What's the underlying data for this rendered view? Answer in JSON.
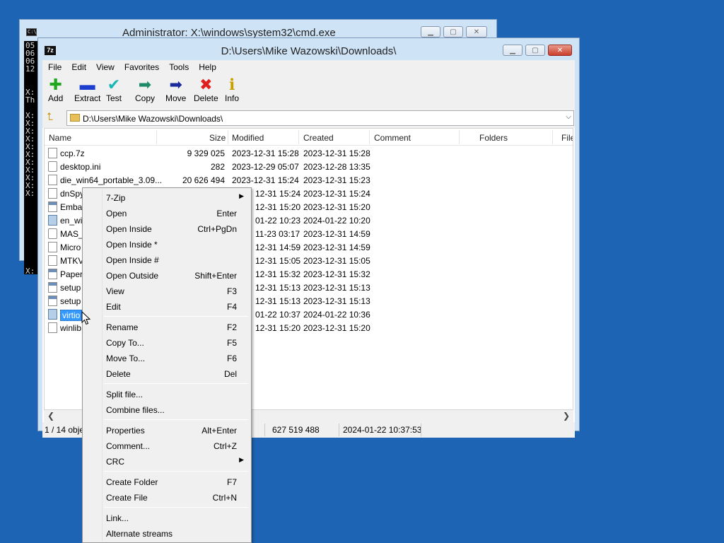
{
  "cmd": {
    "title": "Administrator: X:\\windows\\system32\\cmd.exe",
    "icon_label": "C:\\",
    "lines": [
      "05",
      "06",
      "06",
      "12",
      "",
      "",
      "X:",
      "Th",
      "",
      "X:",
      "X:",
      "X:",
      "X:",
      "X:",
      "X:",
      "X:",
      "X:",
      "X:",
      "X:",
      "X:",
      "",
      "",
      "",
      "",
      "",
      "",
      "",
      "",
      "",
      "X:"
    ]
  },
  "zip": {
    "title": "D:\\Users\\Mike Wazowski\\Downloads\\",
    "icon_label": "7z",
    "menu": [
      "File",
      "Edit",
      "View",
      "Favorites",
      "Tools",
      "Help"
    ],
    "toolbar": [
      {
        "label": "Add",
        "icon": "plus-icon",
        "glyph": "✚",
        "color": "#1fa81f"
      },
      {
        "label": "Extract",
        "icon": "minus-icon",
        "glyph": "▬",
        "color": "#1c3fd0"
      },
      {
        "label": "Test",
        "icon": "check-icon",
        "glyph": "✔",
        "color": "#19b6b6"
      },
      {
        "label": "Copy",
        "icon": "copy-arrow-icon",
        "glyph": "➡",
        "color": "#1e8a6a"
      },
      {
        "label": "Move",
        "icon": "move-arrow-icon",
        "glyph": "➡",
        "color": "#1a2a9a"
      },
      {
        "label": "Delete",
        "icon": "delete-x-icon",
        "glyph": "✖",
        "color": "#e01f1f"
      },
      {
        "label": "Info",
        "icon": "info-icon",
        "glyph": "ℹ",
        "color": "#c9a000"
      }
    ],
    "address": "D:\\Users\\Mike Wazowski\\Downloads\\",
    "columns": {
      "name": "Name",
      "size": "Size",
      "modified": "Modified",
      "created": "Created",
      "comment": "Comment",
      "folders": "Folders",
      "files": "File"
    },
    "files": [
      {
        "name": "ccp.7z",
        "size": "9 329 025",
        "modified": "2023-12-31 15:28",
        "created": "2023-12-31 15:28",
        "icon": "file-icon"
      },
      {
        "name": "desktop.ini",
        "size": "282",
        "modified": "2023-12-29 05:07",
        "created": "2023-12-28 13:35",
        "icon": "settings-file-icon"
      },
      {
        "name": "die_win64_portable_3.09...",
        "size": "20 626 494",
        "modified": "2023-12-31 15:24",
        "created": "2023-12-31 15:23",
        "icon": "file-icon"
      },
      {
        "name": "dnSpy",
        "size": "",
        "modified": "12-31 15:24",
        "created": "2023-12-31 15:24",
        "icon": "file-icon"
      },
      {
        "name": "Emba",
        "size": "",
        "modified": "12-31 15:20",
        "created": "2023-12-31 15:20",
        "icon": "app-icon"
      },
      {
        "name": "en_wi",
        "size": "",
        "modified": "01-22 10:23",
        "created": "2024-01-22 10:20",
        "icon": "disk-image-icon"
      },
      {
        "name": "MAS_",
        "size": "",
        "modified": "11-23 03:17",
        "created": "2023-12-31 14:59",
        "icon": "settings-file-icon"
      },
      {
        "name": "Micro",
        "size": "",
        "modified": "12-31 14:59",
        "created": "2023-12-31 14:59",
        "icon": "file-icon"
      },
      {
        "name": "MTKV",
        "size": "",
        "modified": "12-31 15:05",
        "created": "2023-12-31 15:05",
        "icon": "file-icon"
      },
      {
        "name": "Paper",
        "size": "",
        "modified": "12-31 15:32",
        "created": "2023-12-31 15:32",
        "icon": "app-icon"
      },
      {
        "name": "setup",
        "size": "",
        "modified": "12-31 15:13",
        "created": "2023-12-31 15:13",
        "icon": "app-icon"
      },
      {
        "name": "setup",
        "size": "",
        "modified": "12-31 15:13",
        "created": "2023-12-31 15:13",
        "icon": "app-icon"
      },
      {
        "name": "virtio",
        "size": "",
        "modified": "01-22 10:37",
        "created": "2024-01-22 10:36",
        "icon": "disk-image-icon",
        "selected": true
      },
      {
        "name": "winlib",
        "size": "",
        "modified": "12-31 15:20",
        "created": "2023-12-31 15:20",
        "icon": "file-icon"
      }
    ],
    "status": {
      "selection": "1 / 14 obje",
      "size": "627 519 488",
      "date": "2024-01-22 10:37:53"
    }
  },
  "context_menu": {
    "groups": [
      [
        {
          "label": "7-Zip",
          "shortcut": "",
          "submenu": true
        },
        {
          "label": "Open",
          "shortcut": "Enter"
        },
        {
          "label": "Open Inside",
          "shortcut": "Ctrl+PgDn"
        },
        {
          "label": "Open Inside *",
          "shortcut": ""
        },
        {
          "label": "Open Inside #",
          "shortcut": ""
        },
        {
          "label": "Open Outside",
          "shortcut": "Shift+Enter"
        },
        {
          "label": "View",
          "shortcut": "F3"
        },
        {
          "label": "Edit",
          "shortcut": "F4"
        }
      ],
      [
        {
          "label": "Rename",
          "shortcut": "F2"
        },
        {
          "label": "Copy To...",
          "shortcut": "F5"
        },
        {
          "label": "Move To...",
          "shortcut": "F6"
        },
        {
          "label": "Delete",
          "shortcut": "Del"
        }
      ],
      [
        {
          "label": "Split file...",
          "shortcut": ""
        },
        {
          "label": "Combine files...",
          "shortcut": ""
        }
      ],
      [
        {
          "label": "Properties",
          "shortcut": "Alt+Enter"
        },
        {
          "label": "Comment...",
          "shortcut": "Ctrl+Z"
        },
        {
          "label": "CRC",
          "shortcut": "",
          "submenu": true
        }
      ],
      [
        {
          "label": "Create Folder",
          "shortcut": "F7"
        },
        {
          "label": "Create File",
          "shortcut": "Ctrl+N"
        }
      ],
      [
        {
          "label": "Link...",
          "shortcut": ""
        },
        {
          "label": "Alternate streams",
          "shortcut": ""
        }
      ]
    ]
  }
}
